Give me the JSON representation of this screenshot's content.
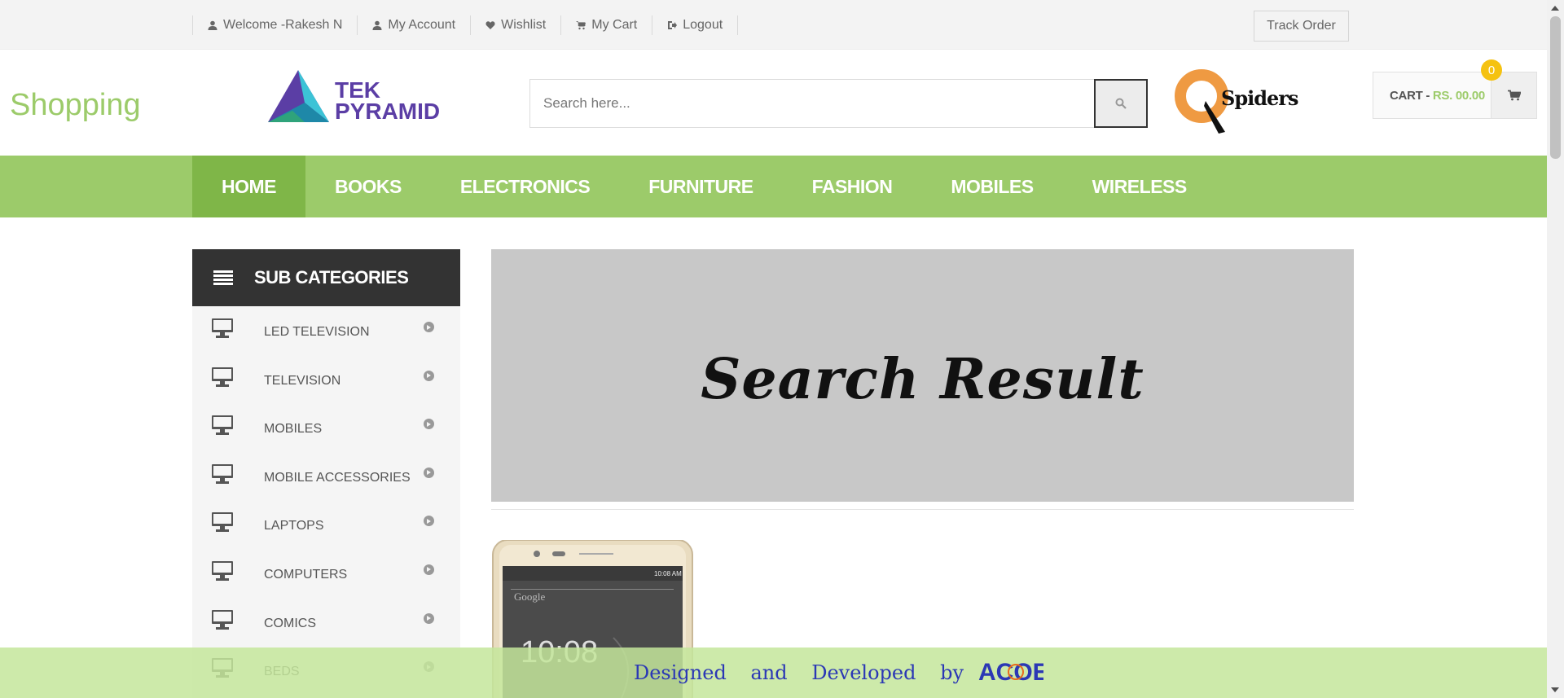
{
  "topbar": {
    "links": [
      {
        "label": "Welcome -Rakesh N",
        "icon": "user-icon"
      },
      {
        "label": "My Account",
        "icon": "user-icon"
      },
      {
        "label": "Wishlist",
        "icon": "heart-icon"
      },
      {
        "label": "My Cart",
        "icon": "cart-icon"
      },
      {
        "label": "Logout",
        "icon": "sign-out-icon"
      }
    ],
    "track_order": "Track Order"
  },
  "header": {
    "title": "Shopping",
    "logo_line1": "TEK",
    "logo_line2": "PYRAMID",
    "search_placeholder": "Search here...",
    "partner_logo_text": "Spiders",
    "cart_label": "CART - ",
    "cart_amount": "RS. 00.00",
    "cart_count": "0"
  },
  "nav": {
    "items": [
      "HOME",
      "BOOKS",
      "ELECTRONICS",
      "FURNITURE",
      "FASHION",
      "MOBILES",
      "WIRELESS"
    ],
    "active": "HOME"
  },
  "sidebar": {
    "title": "SUB CATEGORIES",
    "items": [
      "LED TELEVISION",
      "TELEVISION",
      "MOBILES",
      "MOBILE ACCESSORIES",
      "LAPTOPS",
      "COMPUTERS",
      "COMICS",
      "BEDS"
    ]
  },
  "banner": {
    "text": "Search Result"
  },
  "product": {
    "phone_time": "10:08",
    "phone_status_time": "10:08 AM",
    "search_hint": "Google"
  },
  "footer": {
    "text": "Designed and Developed by",
    "logo_text": "ACOE"
  },
  "colors": {
    "accent_green": "#9ccb6a",
    "active_nav": "#7fb648",
    "badge": "#f5c211",
    "dark": "#333333"
  }
}
